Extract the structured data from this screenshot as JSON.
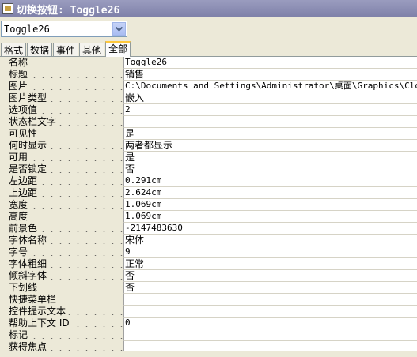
{
  "window": {
    "title": "切换按钮: Toggle26"
  },
  "selector": {
    "value": "Toggle26"
  },
  "tabs": [
    {
      "label": "格式"
    },
    {
      "label": "数据"
    },
    {
      "label": "事件"
    },
    {
      "label": "其他"
    },
    {
      "label": "全部",
      "active": true
    }
  ],
  "properties": [
    {
      "name": "名称",
      "value": "Toggle26"
    },
    {
      "name": "标题",
      "value": "销售"
    },
    {
      "name": "图片",
      "value": "C:\\Documents and Settings\\Administrator\\桌面\\Graphics\\Closeope"
    },
    {
      "name": "图片类型",
      "value": "嵌入"
    },
    {
      "name": "选项值",
      "value": "2"
    },
    {
      "name": "状态栏文字",
      "value": ""
    },
    {
      "name": "可见性",
      "value": "是"
    },
    {
      "name": "何时显示",
      "value": "两者都显示"
    },
    {
      "name": "可用",
      "value": "是"
    },
    {
      "name": "是否锁定",
      "value": "否"
    },
    {
      "name": "左边距",
      "value": "0.291cm"
    },
    {
      "name": "上边距",
      "value": "2.624cm"
    },
    {
      "name": "宽度",
      "value": "1.069cm"
    },
    {
      "name": "高度",
      "value": "1.069cm"
    },
    {
      "name": "前景色",
      "value": "-2147483630"
    },
    {
      "name": "字体名称",
      "value": "宋体"
    },
    {
      "name": "字号",
      "value": "9"
    },
    {
      "name": "字体粗细",
      "value": "正常"
    },
    {
      "name": "倾斜字体",
      "value": "否"
    },
    {
      "name": "下划线",
      "value": "否"
    },
    {
      "name": "快捷菜单栏",
      "value": ""
    },
    {
      "name": "控件提示文本",
      "value": ""
    },
    {
      "name": "帮助上下文 ID",
      "value": "0"
    },
    {
      "name": "标记",
      "value": ""
    },
    {
      "name": "获得焦点",
      "value": ""
    }
  ]
}
